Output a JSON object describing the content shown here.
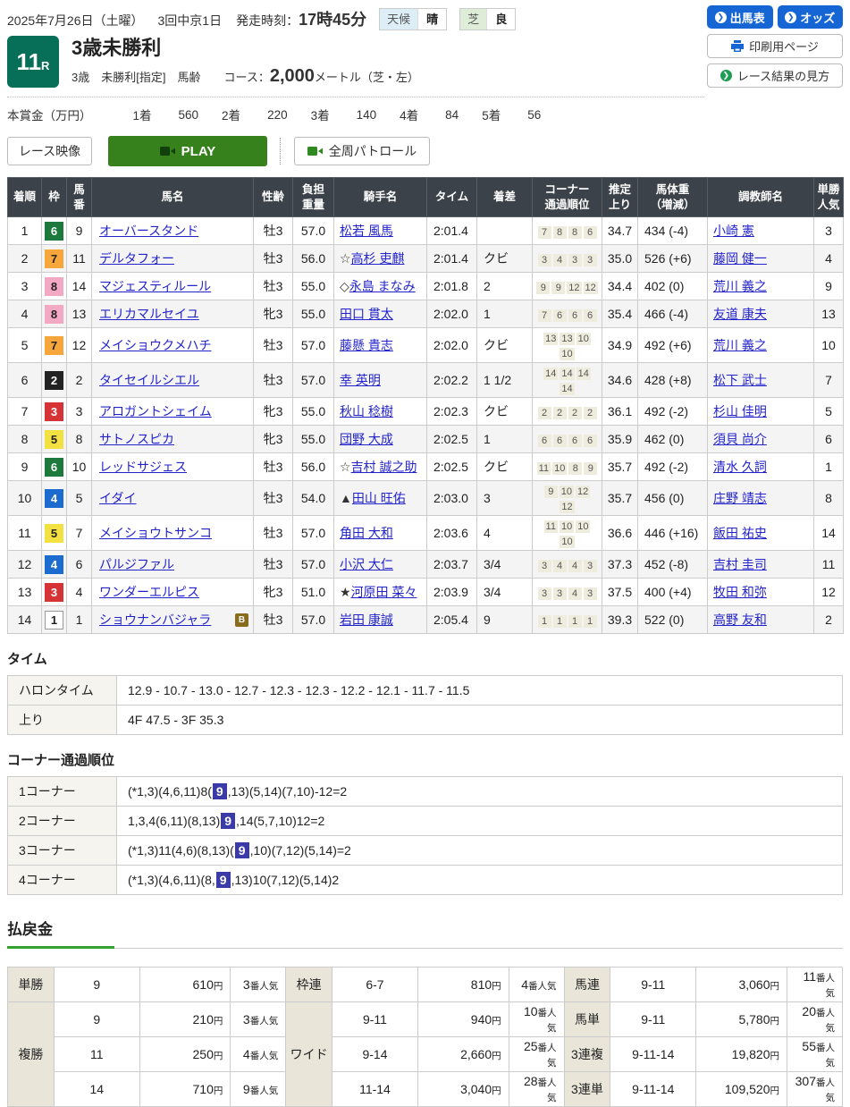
{
  "top": {
    "date": "2025年7月26日（土曜）",
    "meeting": "3回中京1日",
    "start_label": "発走時刻：",
    "start_time": "17時45分",
    "weather": {
      "label": "天候",
      "value": "晴"
    },
    "turf": {
      "label": "芝",
      "value": "良"
    },
    "buttons": {
      "shutsuba": "出馬表",
      "odds": "オッズ",
      "print": "印刷用ページ",
      "guide": "レース結果の見方"
    }
  },
  "race": {
    "number": "11",
    "number_suffix": "R",
    "title": "3歳未勝利",
    "conditions": "3歳　未勝利[指定]　馬齢",
    "course_label": "コース：",
    "course_value": "2,000",
    "course_suffix": "メートル（芝・左）"
  },
  "prize": {
    "label": "本賞金（万円）",
    "items": [
      {
        "place": "1着",
        "amount": "560"
      },
      {
        "place": "2着",
        "amount": "220"
      },
      {
        "place": "3着",
        "amount": "140"
      },
      {
        "place": "4着",
        "amount": "84"
      },
      {
        "place": "5着",
        "amount": "56"
      }
    ]
  },
  "video": {
    "race_video": "レース映像",
    "play": "PLAY",
    "patrol": "全周パトロール"
  },
  "results": {
    "headers": {
      "rank": "着順",
      "waku": "枠",
      "num": "馬\n番",
      "horse": "馬名",
      "sex": "性齢",
      "weight": "負担\n重量",
      "jockey": "騎手名",
      "time": "タイム",
      "margin": "着差",
      "corner": "コーナー\n通過順位",
      "agari": "推定\n上り",
      "bw": "馬体重\n（増減）",
      "trainer": "調教師名",
      "pop": "単勝\n人気"
    },
    "rows": [
      {
        "rank": "1",
        "waku": "6",
        "num": "9",
        "horse": "オーバースタンド",
        "badge": "",
        "sex": "牡3",
        "wt": "57.0",
        "jp": "",
        "jockey": "松若 風馬",
        "time": "2:01.4",
        "margin": "",
        "corners": [
          "7",
          "8",
          "8",
          "6"
        ],
        "agari": "34.7",
        "bw": "434 (-4)",
        "trainer": "小崎 憲",
        "pop": "3"
      },
      {
        "rank": "2",
        "waku": "7",
        "num": "11",
        "horse": "デルタフォー",
        "badge": "",
        "sex": "牡3",
        "wt": "56.0",
        "jp": "☆",
        "jockey": "高杉 吏麒",
        "time": "2:01.4",
        "margin": "クビ",
        "corners": [
          "3",
          "4",
          "3",
          "3"
        ],
        "agari": "35.0",
        "bw": "526 (+6)",
        "trainer": "藤岡 健一",
        "pop": "4"
      },
      {
        "rank": "3",
        "waku": "8",
        "num": "14",
        "horse": "マジェスティルール",
        "badge": "",
        "sex": "牡3",
        "wt": "55.0",
        "jp": "◇",
        "jockey": "永島 まなみ",
        "time": "2:01.8",
        "margin": "2",
        "corners": [
          "9",
          "9",
          "12",
          "12"
        ],
        "agari": "34.4",
        "bw": "402 (0)",
        "trainer": "荒川 義之",
        "pop": "9"
      },
      {
        "rank": "4",
        "waku": "8",
        "num": "13",
        "horse": "エリカマルセイユ",
        "badge": "",
        "sex": "牝3",
        "wt": "55.0",
        "jp": "",
        "jockey": "田口 貫太",
        "time": "2:02.0",
        "margin": "1",
        "corners": [
          "7",
          "6",
          "6",
          "6"
        ],
        "agari": "35.4",
        "bw": "466 (-4)",
        "trainer": "友道 康夫",
        "pop": "13"
      },
      {
        "rank": "5",
        "waku": "7",
        "num": "12",
        "horse": "メイショウクメハチ",
        "badge": "",
        "sex": "牡3",
        "wt": "57.0",
        "jp": "",
        "jockey": "藤懸 貴志",
        "time": "2:02.0",
        "margin": "クビ",
        "corners": [
          "13",
          "13",
          "10",
          "10"
        ],
        "agari": "34.9",
        "bw": "492 (+6)",
        "trainer": "荒川 義之",
        "pop": "10"
      },
      {
        "rank": "6",
        "waku": "2",
        "num": "2",
        "horse": "タイセイルシエル",
        "badge": "",
        "sex": "牡3",
        "wt": "57.0",
        "jp": "",
        "jockey": "幸 英明",
        "time": "2:02.2",
        "margin": "1 1/2",
        "corners": [
          "14",
          "14",
          "14",
          "14"
        ],
        "agari": "34.6",
        "bw": "428 (+8)",
        "trainer": "松下 武士",
        "pop": "7"
      },
      {
        "rank": "7",
        "waku": "3",
        "num": "3",
        "horse": "アロガントシェイム",
        "badge": "",
        "sex": "牝3",
        "wt": "55.0",
        "jp": "",
        "jockey": "秋山 稔樹",
        "time": "2:02.3",
        "margin": "クビ",
        "corners": [
          "2",
          "2",
          "2",
          "2"
        ],
        "agari": "36.1",
        "bw": "492 (-2)",
        "trainer": "杉山 佳明",
        "pop": "5"
      },
      {
        "rank": "8",
        "waku": "5",
        "num": "8",
        "horse": "サトノスピカ",
        "badge": "",
        "sex": "牝3",
        "wt": "55.0",
        "jp": "",
        "jockey": "団野 大成",
        "time": "2:02.5",
        "margin": "1",
        "corners": [
          "6",
          "6",
          "6",
          "6"
        ],
        "agari": "35.9",
        "bw": "462 (0)",
        "trainer": "須貝 尚介",
        "pop": "6"
      },
      {
        "rank": "9",
        "waku": "6",
        "num": "10",
        "horse": "レッドサジェス",
        "badge": "",
        "sex": "牡3",
        "wt": "56.0",
        "jp": "☆",
        "jockey": "吉村 誠之助",
        "time": "2:02.5",
        "margin": "クビ",
        "corners": [
          "11",
          "10",
          "8",
          "9"
        ],
        "agari": "35.7",
        "bw": "492 (-2)",
        "trainer": "清水 久詞",
        "pop": "1"
      },
      {
        "rank": "10",
        "waku": "4",
        "num": "5",
        "horse": "イダイ",
        "badge": "",
        "sex": "牡3",
        "wt": "54.0",
        "jp": "▲",
        "jockey": "田山 旺佑",
        "time": "2:03.0",
        "margin": "3",
        "corners": [
          "9",
          "10",
          "12",
          "12"
        ],
        "agari": "35.7",
        "bw": "456 (0)",
        "trainer": "庄野 靖志",
        "pop": "8"
      },
      {
        "rank": "11",
        "waku": "5",
        "num": "7",
        "horse": "メイショウトサンコ",
        "badge": "",
        "sex": "牡3",
        "wt": "57.0",
        "jp": "",
        "jockey": "角田 大和",
        "time": "2:03.6",
        "margin": "4",
        "corners": [
          "11",
          "10",
          "10",
          "10"
        ],
        "agari": "36.6",
        "bw": "446 (+16)",
        "trainer": "飯田 祐史",
        "pop": "14"
      },
      {
        "rank": "12",
        "waku": "4",
        "num": "6",
        "horse": "パルジファル",
        "badge": "",
        "sex": "牡3",
        "wt": "57.0",
        "jp": "",
        "jockey": "小沢 大仁",
        "time": "2:03.7",
        "margin": "3/4",
        "corners": [
          "3",
          "4",
          "4",
          "3"
        ],
        "agari": "37.3",
        "bw": "452 (-8)",
        "trainer": "吉村 圭司",
        "pop": "11"
      },
      {
        "rank": "13",
        "waku": "3",
        "num": "4",
        "horse": "ワンダーエルピス",
        "badge": "",
        "sex": "牝3",
        "wt": "51.0",
        "jp": "★",
        "jockey": "河原田 菜々",
        "time": "2:03.9",
        "margin": "3/4",
        "corners": [
          "3",
          "3",
          "4",
          "3"
        ],
        "agari": "37.5",
        "bw": "400 (+4)",
        "trainer": "牧田 和弥",
        "pop": "12"
      },
      {
        "rank": "14",
        "waku": "1",
        "num": "1",
        "horse": "ショウナンバジャラ",
        "badge": "B",
        "sex": "牡3",
        "wt": "57.0",
        "jp": "",
        "jockey": "岩田 康誠",
        "time": "2:05.4",
        "margin": "9",
        "corners": [
          "1",
          "1",
          "1",
          "1"
        ],
        "agari": "39.3",
        "bw": "522 (0)",
        "trainer": "高野 友和",
        "pop": "2"
      }
    ]
  },
  "time_section": {
    "title": "タイム",
    "rows": [
      {
        "label": "ハロンタイム",
        "value": "12.9 - 10.7 - 13.0 - 12.7 - 12.3 - 12.3 - 12.2 - 12.1 - 11.7 - 11.5"
      },
      {
        "label": "上り",
        "value": "4F 47.5 - 3F 35.3"
      }
    ]
  },
  "corner_section": {
    "title": "コーナー通過順位",
    "rows": [
      {
        "label": "1コーナー",
        "pre": "(*1,3)(4,6,11)8(",
        "mark": "9",
        "post": ",13)(5,14)(7,10)-12=2"
      },
      {
        "label": "2コーナー",
        "pre": "1,3,4(6,11)(8,13)",
        "mark": "9",
        "post": ",14(5,7,10)12=2"
      },
      {
        "label": "3コーナー",
        "pre": "(*1,3)11(4,6)(8,13)(",
        "mark": "9",
        "post": ",10)(7,12)(5,14)=2"
      },
      {
        "label": "4コーナー",
        "pre": "(*1,3)(4,6,11)(8,",
        "mark": "9",
        "post": ",13)10(7,12)(5,14)2"
      }
    ]
  },
  "payout": {
    "title": "払戻金",
    "units": {
      "yen": "円",
      "ninki": "番人気"
    },
    "tansho": {
      "label": "単勝",
      "bet": "9",
      "amount": "610",
      "pop": "3"
    },
    "fukusho": {
      "label": "複勝",
      "rows": [
        {
          "bet": "9",
          "amount": "210",
          "pop": "3"
        },
        {
          "bet": "11",
          "amount": "250",
          "pop": "4"
        },
        {
          "bet": "14",
          "amount": "710",
          "pop": "9"
        }
      ]
    },
    "wakuren": {
      "label": "枠連",
      "bet": "6-7",
      "amount": "810",
      "pop": "4"
    },
    "wide": {
      "label": "ワイド",
      "rows": [
        {
          "bet": "9-11",
          "amount": "940",
          "pop": "10"
        },
        {
          "bet": "9-14",
          "amount": "2,660",
          "pop": "25"
        },
        {
          "bet": "11-14",
          "amount": "3,040",
          "pop": "28"
        }
      ]
    },
    "umaren": {
      "label": "馬連",
      "bet": "9-11",
      "amount": "3,060",
      "pop": "11"
    },
    "umatan": {
      "label": "馬単",
      "bet": "9-11",
      "amount": "5,780",
      "pop": "20"
    },
    "sanrenpuku": {
      "label": "3連複",
      "bet": "9-11-14",
      "amount": "19,820",
      "pop": "55"
    },
    "sanrentan": {
      "label": "3連単",
      "bet": "9-11-14",
      "amount": "109,520",
      "pop": "307"
    }
  }
}
